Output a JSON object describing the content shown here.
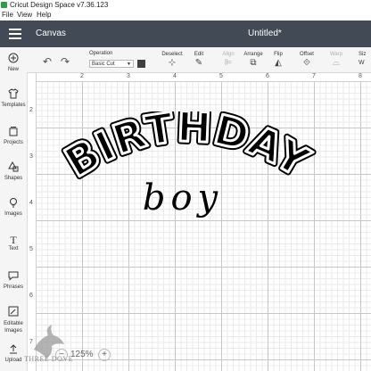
{
  "window": {
    "title": "Cricut Design Space  v7.36.123"
  },
  "menu": [
    "File",
    "View",
    "Help"
  ],
  "header": {
    "section": "Canvas",
    "document_title": "Untitled*"
  },
  "toolbar": {
    "operation_label": "Operation",
    "operation_value": "Basic Cut",
    "color_swatch": "#404040",
    "deselect": "Deselect",
    "edit": "Edit",
    "align": "Align",
    "arrange": "Arrange",
    "flip": "Flip",
    "offset": "Offset",
    "warp": "Warp",
    "size": "Siz"
  },
  "sidebar": [
    {
      "label": "New",
      "icon": "plus-icon"
    },
    {
      "label": "Templates",
      "icon": "shirt-icon"
    },
    {
      "label": "Projects",
      "icon": "projects-icon"
    },
    {
      "label": "Shapes",
      "icon": "shapes-icon"
    },
    {
      "label": "Images",
      "icon": "lightbulb-icon"
    },
    {
      "label": "Text",
      "icon": "text-icon"
    },
    {
      "label": "Phrases",
      "icon": "speech-bubble-icon"
    },
    {
      "label": "Editable Images",
      "icon": "editable-image-icon"
    },
    {
      "label": "Upload",
      "icon": "upload-icon"
    }
  ],
  "ruler": {
    "top": [
      "2",
      "3",
      "4",
      "5",
      "6",
      "7",
      "8"
    ],
    "left": [
      "2",
      "3",
      "4",
      "5",
      "6",
      "7"
    ]
  },
  "design": {
    "main_text": "BIRTHDAY",
    "script_text": "boy"
  },
  "zoom": {
    "minus": "−",
    "value": "125%",
    "plus": "+"
  },
  "watermark": {
    "text": "THREE DOVE"
  },
  "colors": {
    "appbar": "#414a55",
    "toolbar": "#f5f5f5",
    "grid_major": "#c7c7c7",
    "grid_minor": "#ebebeb",
    "accent": "#2b9e4a"
  }
}
